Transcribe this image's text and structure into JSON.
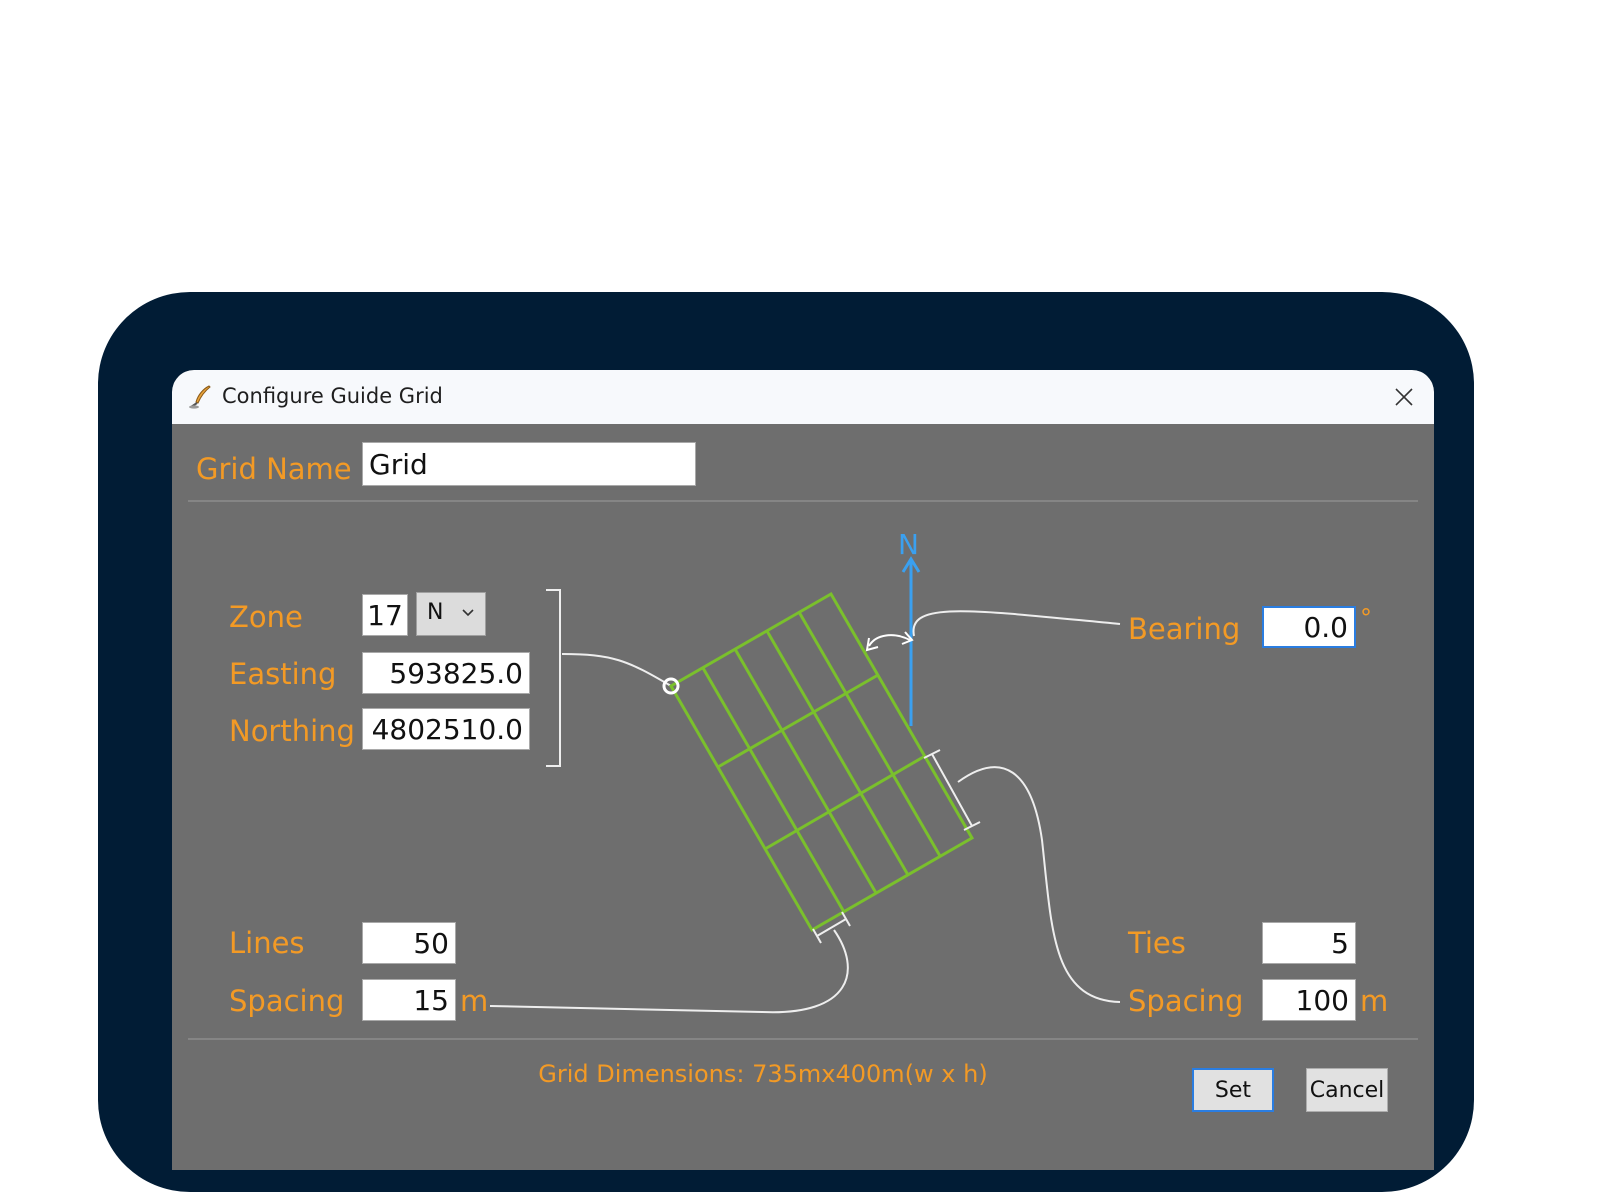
{
  "window": {
    "title": "Configure Guide Grid",
    "app_icon": "quill-pen-icon",
    "close_icon": "close-icon"
  },
  "grid_name": {
    "label": "Grid Name",
    "value": "Grid"
  },
  "location": {
    "zone_label": "Zone",
    "zone_value": "17",
    "hemisphere_value": "N",
    "easting_label": "Easting",
    "easting_value": "593825.0",
    "northing_label": "Northing",
    "northing_value": "4802510.0"
  },
  "bearing": {
    "label": "Bearing",
    "value": "0.0",
    "unit": "°"
  },
  "diagram": {
    "north_label": "N",
    "grid_color": "#7ac02c",
    "north_color": "#3aa0f0"
  },
  "lines": {
    "label": "Lines",
    "value": "50",
    "spacing_label": "Spacing",
    "spacing_value": "15",
    "spacing_unit": "m"
  },
  "ties": {
    "label": "Ties",
    "value": "5",
    "spacing_label": "Spacing",
    "spacing_value": "100",
    "spacing_unit": "m"
  },
  "status": {
    "text": "Grid Dimensions: 735mx400m(w x h)"
  },
  "buttons": {
    "set": "Set",
    "cancel": "Cancel"
  },
  "colors": {
    "accent": "#f39a25",
    "panel": "#6e6e6e",
    "frame": "#011c35",
    "focus": "#2a7de1"
  }
}
